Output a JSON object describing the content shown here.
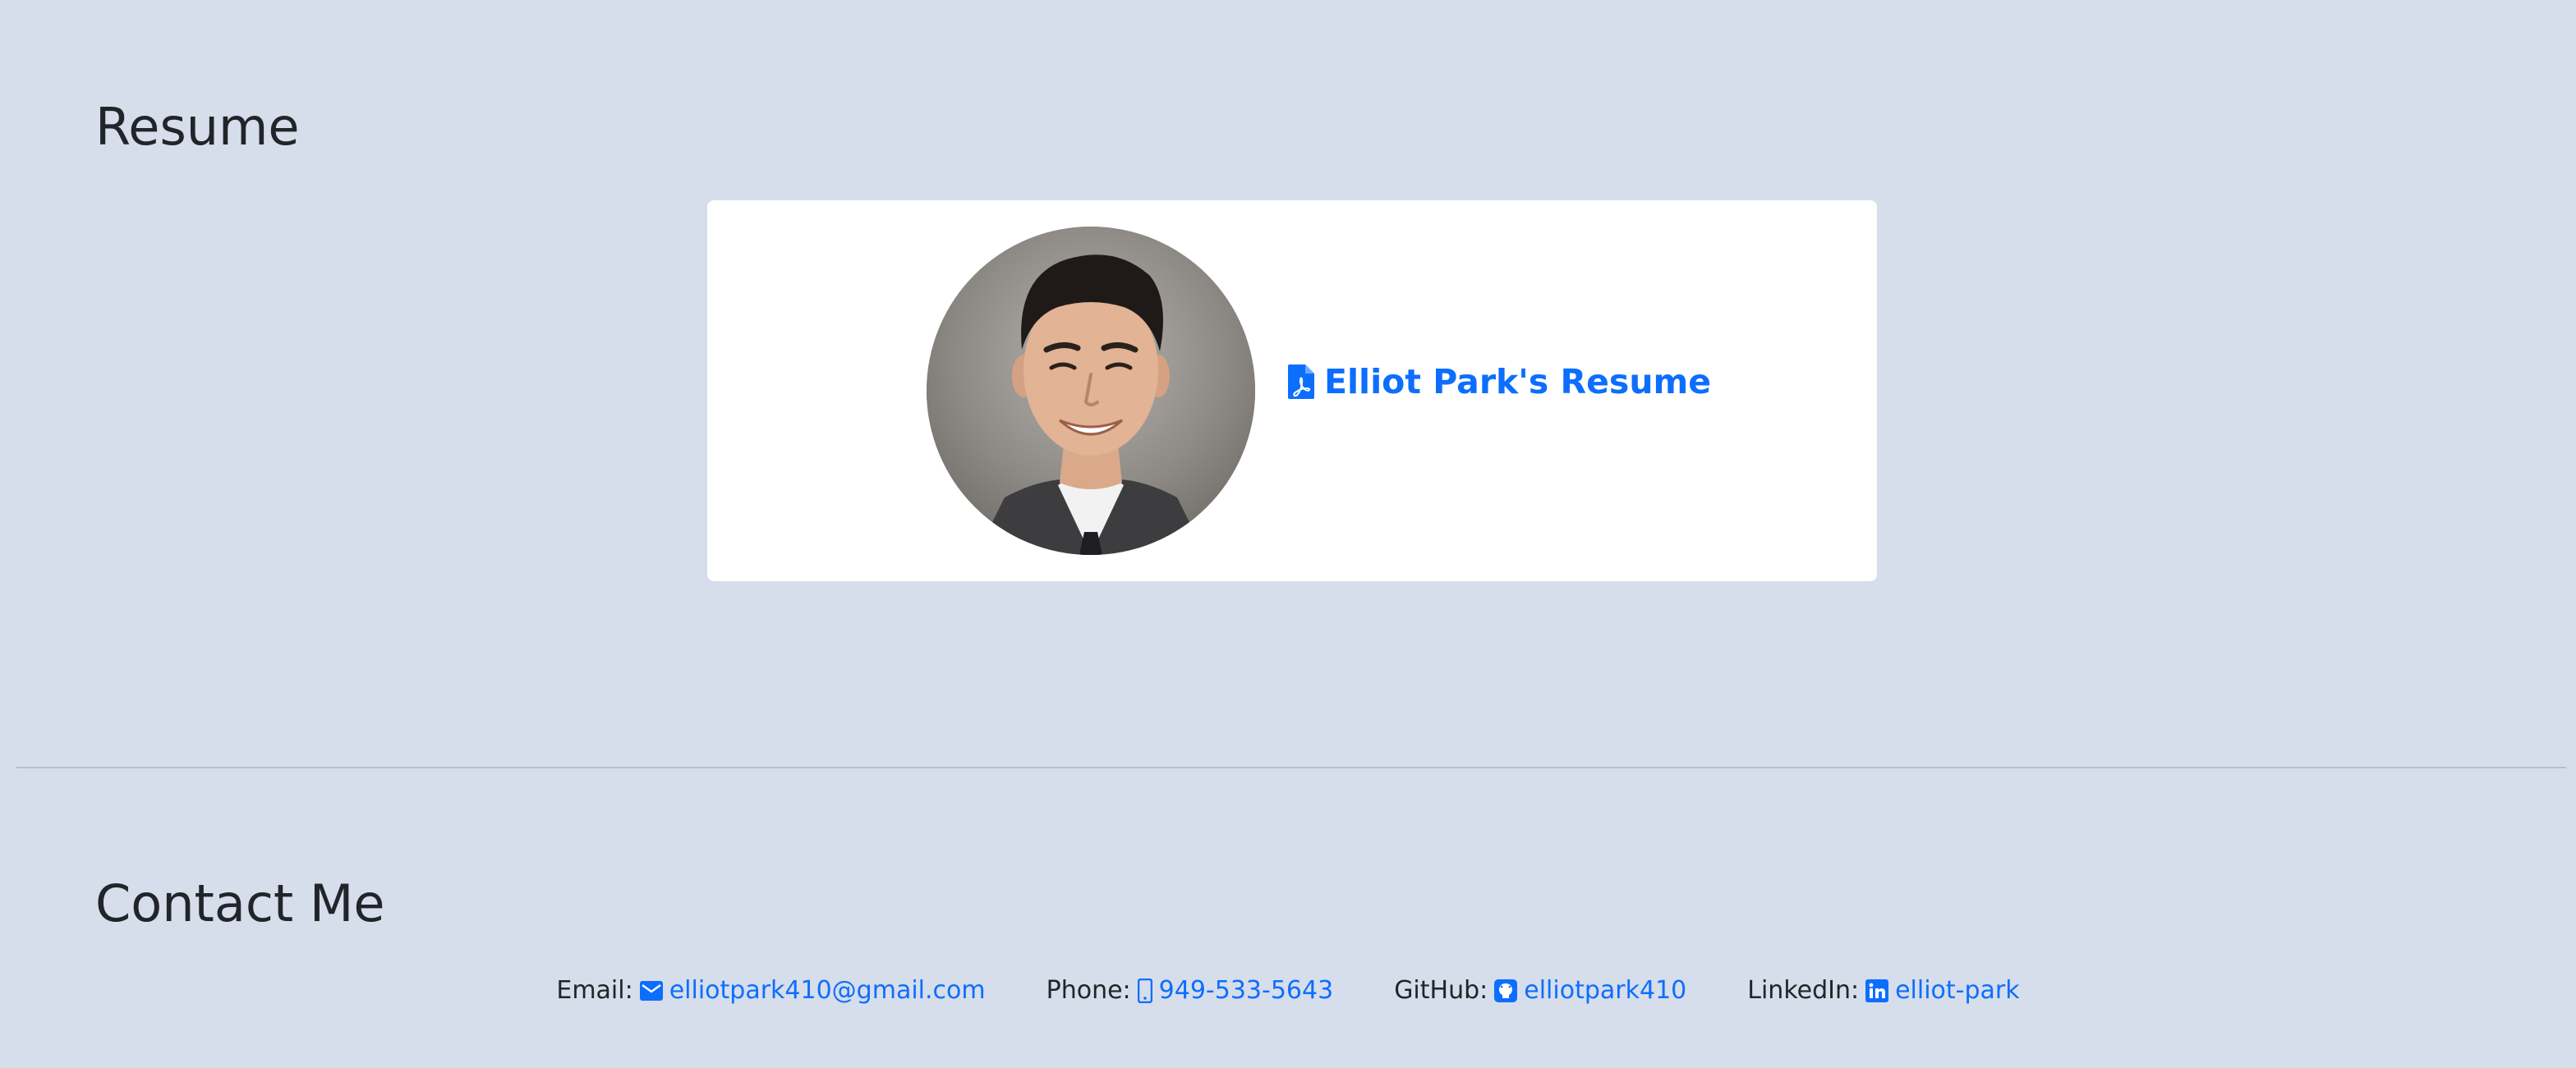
{
  "resume_section": {
    "title": "Resume",
    "link_label": "Elliot Park's Resume",
    "link_icon": "file-pdf-icon",
    "photo_alt": "Elliot Park"
  },
  "contact_section": {
    "title": "Contact Me",
    "items": [
      {
        "label": "Email:",
        "icon": "envelope-icon",
        "value": "elliotpark410@gmail.com"
      },
      {
        "label": "Phone:",
        "icon": "phone-icon",
        "value": "949-533-5643"
      },
      {
        "label": "GitHub:",
        "icon": "github-icon",
        "value": "elliotpark410"
      },
      {
        "label": "LinkedIn:",
        "icon": "linkedin-icon",
        "value": "elliot-park"
      }
    ]
  },
  "colors": {
    "background": "#d6ddeb",
    "card": "#ffffff",
    "link": "#0d6efd",
    "heading": "#212529"
  }
}
